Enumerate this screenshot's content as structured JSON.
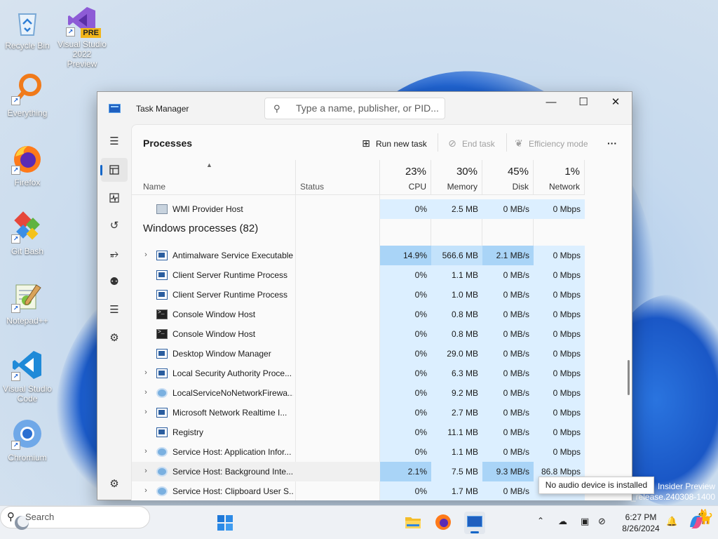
{
  "desktop": {
    "icons": [
      {
        "label": "Recycle Bin",
        "icon": "recycle-bin-icon"
      },
      {
        "label": "Visual Studio 2022 Preview",
        "icon": "visual-studio-icon",
        "badge": "PRE"
      },
      {
        "label": "Everything",
        "icon": "everything-search-icon"
      },
      {
        "label": "Firefox",
        "icon": "firefox-icon"
      },
      {
        "label": "Git Bash",
        "icon": "git-bash-icon"
      },
      {
        "label": "Notepad++",
        "icon": "notepad-plus-plus-icon"
      },
      {
        "label": "Visual Studio Code",
        "icon": "vscode-icon"
      },
      {
        "label": "Chromium",
        "icon": "chromium-icon"
      }
    ],
    "watermark_line1": "Insider Preview",
    "watermark_line2": "_release.240308-1400"
  },
  "window": {
    "title": "Task Manager",
    "search_placeholder": "Type a name, publisher, or PID...",
    "controls": {
      "minimize": "—",
      "maximize": "☐",
      "close": "✕"
    }
  },
  "toolbar": {
    "page_title": "Processes",
    "run_new_task": "Run new task",
    "end_task": "End task",
    "efficiency_mode": "Efficiency mode",
    "more": "···"
  },
  "columns": {
    "name": "Name",
    "status": "Status",
    "cpu": {
      "pct": "23%",
      "label": "CPU"
    },
    "memory": {
      "pct": "30%",
      "label": "Memory"
    },
    "disk": {
      "pct": "45%",
      "label": "Disk"
    },
    "network": {
      "pct": "1%",
      "label": "Network"
    }
  },
  "rows_top": [
    {
      "name": "WMI Provider Host",
      "icon": "wmi-icon",
      "expandable": false,
      "cpu": "0%",
      "memory": "2.5 MB",
      "disk": "0 MB/s",
      "network": "0 Mbps"
    }
  ],
  "group": {
    "title": "Windows processes (82)"
  },
  "rows": [
    {
      "name": "Antimalware Service Executable",
      "icon": "window-icon",
      "expandable": true,
      "cpu": "14.9%",
      "memory": "566.6 MB",
      "disk": "2.1 MB/s",
      "network": "0 Mbps",
      "heat": {
        "cpu": 3,
        "memory": 2,
        "disk": 3,
        "network": 1
      }
    },
    {
      "name": "Client Server Runtime Process",
      "icon": "window-icon",
      "expandable": false,
      "cpu": "0%",
      "memory": "1.1 MB",
      "disk": "0 MB/s",
      "network": "0 Mbps"
    },
    {
      "name": "Client Server Runtime Process",
      "icon": "window-icon",
      "expandable": false,
      "cpu": "0%",
      "memory": "1.0 MB",
      "disk": "0 MB/s",
      "network": "0 Mbps"
    },
    {
      "name": "Console Window Host",
      "icon": "console-icon",
      "expandable": false,
      "cpu": "0%",
      "memory": "0.8 MB",
      "disk": "0 MB/s",
      "network": "0 Mbps"
    },
    {
      "name": "Console Window Host",
      "icon": "console-icon",
      "expandable": false,
      "cpu": "0%",
      "memory": "0.8 MB",
      "disk": "0 MB/s",
      "network": "0 Mbps"
    },
    {
      "name": "Desktop Window Manager",
      "icon": "window-icon",
      "expandable": false,
      "cpu": "0%",
      "memory": "29.0 MB",
      "disk": "0 MB/s",
      "network": "0 Mbps"
    },
    {
      "name": "Local Security Authority Proce...",
      "icon": "window-icon",
      "expandable": true,
      "cpu": "0%",
      "memory": "6.3 MB",
      "disk": "0 MB/s",
      "network": "0 Mbps"
    },
    {
      "name": "LocalServiceNoNetworkFirewa...",
      "icon": "gear-icon",
      "expandable": true,
      "cpu": "0%",
      "memory": "9.2 MB",
      "disk": "0 MB/s",
      "network": "0 Mbps"
    },
    {
      "name": "Microsoft Network Realtime I...",
      "icon": "window-icon",
      "expandable": true,
      "cpu": "0%",
      "memory": "2.7 MB",
      "disk": "0 MB/s",
      "network": "0 Mbps"
    },
    {
      "name": "Registry",
      "icon": "window-icon",
      "expandable": false,
      "cpu": "0%",
      "memory": "11.1 MB",
      "disk": "0 MB/s",
      "network": "0 Mbps"
    },
    {
      "name": "Service Host: Application Infor...",
      "icon": "gear-icon",
      "expandable": true,
      "cpu": "0%",
      "memory": "1.1 MB",
      "disk": "0 MB/s",
      "network": "0 Mbps"
    },
    {
      "name": "Service Host: Background Inte...",
      "icon": "gear-icon",
      "expandable": true,
      "hover": true,
      "cpu": "2.1%",
      "memory": "7.5 MB",
      "disk": "9.3 MB/s",
      "network": "86.8 Mbps",
      "heat": {
        "cpu": 3,
        "memory": 1,
        "disk": 3,
        "network": 1
      }
    },
    {
      "name": "Service Host: Clipboard User S...",
      "icon": "gear-icon",
      "expandable": true,
      "cpu": "0%",
      "memory": "1.7 MB",
      "disk": "0 MB/s",
      "network": ""
    }
  ],
  "heat_colors": {
    "1": "#dcefff",
    "2": "#c3e2fb",
    "3": "#a9d4f7"
  },
  "tooltip": "No audio device is installed",
  "taskbar": {
    "search_label": "Search",
    "clock_time": "6:27 PM",
    "clock_date": "8/26/2024"
  }
}
